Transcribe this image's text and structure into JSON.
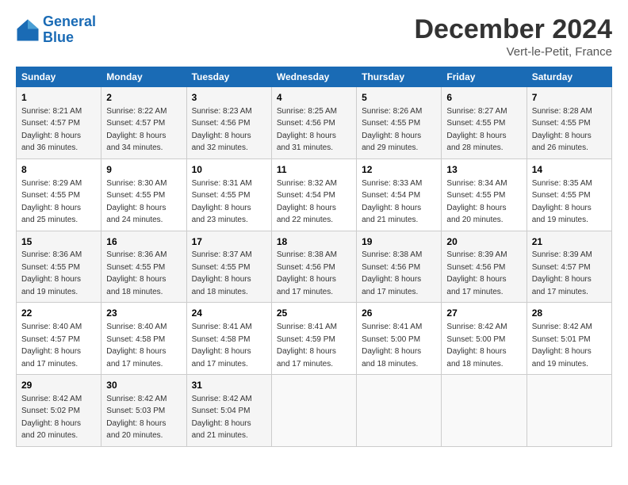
{
  "header": {
    "logo_line1": "General",
    "logo_line2": "Blue",
    "month_title": "December 2024",
    "location": "Vert-le-Petit, France"
  },
  "days_of_week": [
    "Sunday",
    "Monday",
    "Tuesday",
    "Wednesday",
    "Thursday",
    "Friday",
    "Saturday"
  ],
  "weeks": [
    [
      {
        "day": "1",
        "sunrise": "Sunrise: 8:21 AM",
        "sunset": "Sunset: 4:57 PM",
        "daylight": "Daylight: 8 hours and 36 minutes."
      },
      {
        "day": "2",
        "sunrise": "Sunrise: 8:22 AM",
        "sunset": "Sunset: 4:57 PM",
        "daylight": "Daylight: 8 hours and 34 minutes."
      },
      {
        "day": "3",
        "sunrise": "Sunrise: 8:23 AM",
        "sunset": "Sunset: 4:56 PM",
        "daylight": "Daylight: 8 hours and 32 minutes."
      },
      {
        "day": "4",
        "sunrise": "Sunrise: 8:25 AM",
        "sunset": "Sunset: 4:56 PM",
        "daylight": "Daylight: 8 hours and 31 minutes."
      },
      {
        "day": "5",
        "sunrise": "Sunrise: 8:26 AM",
        "sunset": "Sunset: 4:55 PM",
        "daylight": "Daylight: 8 hours and 29 minutes."
      },
      {
        "day": "6",
        "sunrise": "Sunrise: 8:27 AM",
        "sunset": "Sunset: 4:55 PM",
        "daylight": "Daylight: 8 hours and 28 minutes."
      },
      {
        "day": "7",
        "sunrise": "Sunrise: 8:28 AM",
        "sunset": "Sunset: 4:55 PM",
        "daylight": "Daylight: 8 hours and 26 minutes."
      }
    ],
    [
      {
        "day": "8",
        "sunrise": "Sunrise: 8:29 AM",
        "sunset": "Sunset: 4:55 PM",
        "daylight": "Daylight: 8 hours and 25 minutes."
      },
      {
        "day": "9",
        "sunrise": "Sunrise: 8:30 AM",
        "sunset": "Sunset: 4:55 PM",
        "daylight": "Daylight: 8 hours and 24 minutes."
      },
      {
        "day": "10",
        "sunrise": "Sunrise: 8:31 AM",
        "sunset": "Sunset: 4:55 PM",
        "daylight": "Daylight: 8 hours and 23 minutes."
      },
      {
        "day": "11",
        "sunrise": "Sunrise: 8:32 AM",
        "sunset": "Sunset: 4:54 PM",
        "daylight": "Daylight: 8 hours and 22 minutes."
      },
      {
        "day": "12",
        "sunrise": "Sunrise: 8:33 AM",
        "sunset": "Sunset: 4:54 PM",
        "daylight": "Daylight: 8 hours and 21 minutes."
      },
      {
        "day": "13",
        "sunrise": "Sunrise: 8:34 AM",
        "sunset": "Sunset: 4:55 PM",
        "daylight": "Daylight: 8 hours and 20 minutes."
      },
      {
        "day": "14",
        "sunrise": "Sunrise: 8:35 AM",
        "sunset": "Sunset: 4:55 PM",
        "daylight": "Daylight: 8 hours and 19 minutes."
      }
    ],
    [
      {
        "day": "15",
        "sunrise": "Sunrise: 8:36 AM",
        "sunset": "Sunset: 4:55 PM",
        "daylight": "Daylight: 8 hours and 19 minutes."
      },
      {
        "day": "16",
        "sunrise": "Sunrise: 8:36 AM",
        "sunset": "Sunset: 4:55 PM",
        "daylight": "Daylight: 8 hours and 18 minutes."
      },
      {
        "day": "17",
        "sunrise": "Sunrise: 8:37 AM",
        "sunset": "Sunset: 4:55 PM",
        "daylight": "Daylight: 8 hours and 18 minutes."
      },
      {
        "day": "18",
        "sunrise": "Sunrise: 8:38 AM",
        "sunset": "Sunset: 4:56 PM",
        "daylight": "Daylight: 8 hours and 17 minutes."
      },
      {
        "day": "19",
        "sunrise": "Sunrise: 8:38 AM",
        "sunset": "Sunset: 4:56 PM",
        "daylight": "Daylight: 8 hours and 17 minutes."
      },
      {
        "day": "20",
        "sunrise": "Sunrise: 8:39 AM",
        "sunset": "Sunset: 4:56 PM",
        "daylight": "Daylight: 8 hours and 17 minutes."
      },
      {
        "day": "21",
        "sunrise": "Sunrise: 8:39 AM",
        "sunset": "Sunset: 4:57 PM",
        "daylight": "Daylight: 8 hours and 17 minutes."
      }
    ],
    [
      {
        "day": "22",
        "sunrise": "Sunrise: 8:40 AM",
        "sunset": "Sunset: 4:57 PM",
        "daylight": "Daylight: 8 hours and 17 minutes."
      },
      {
        "day": "23",
        "sunrise": "Sunrise: 8:40 AM",
        "sunset": "Sunset: 4:58 PM",
        "daylight": "Daylight: 8 hours and 17 minutes."
      },
      {
        "day": "24",
        "sunrise": "Sunrise: 8:41 AM",
        "sunset": "Sunset: 4:58 PM",
        "daylight": "Daylight: 8 hours and 17 minutes."
      },
      {
        "day": "25",
        "sunrise": "Sunrise: 8:41 AM",
        "sunset": "Sunset: 4:59 PM",
        "daylight": "Daylight: 8 hours and 17 minutes."
      },
      {
        "day": "26",
        "sunrise": "Sunrise: 8:41 AM",
        "sunset": "Sunset: 5:00 PM",
        "daylight": "Daylight: 8 hours and 18 minutes."
      },
      {
        "day": "27",
        "sunrise": "Sunrise: 8:42 AM",
        "sunset": "Sunset: 5:00 PM",
        "daylight": "Daylight: 8 hours and 18 minutes."
      },
      {
        "day": "28",
        "sunrise": "Sunrise: 8:42 AM",
        "sunset": "Sunset: 5:01 PM",
        "daylight": "Daylight: 8 hours and 19 minutes."
      }
    ],
    [
      {
        "day": "29",
        "sunrise": "Sunrise: 8:42 AM",
        "sunset": "Sunset: 5:02 PM",
        "daylight": "Daylight: 8 hours and 20 minutes."
      },
      {
        "day": "30",
        "sunrise": "Sunrise: 8:42 AM",
        "sunset": "Sunset: 5:03 PM",
        "daylight": "Daylight: 8 hours and 20 minutes."
      },
      {
        "day": "31",
        "sunrise": "Sunrise: 8:42 AM",
        "sunset": "Sunset: 5:04 PM",
        "daylight": "Daylight: 8 hours and 21 minutes."
      },
      null,
      null,
      null,
      null
    ]
  ]
}
